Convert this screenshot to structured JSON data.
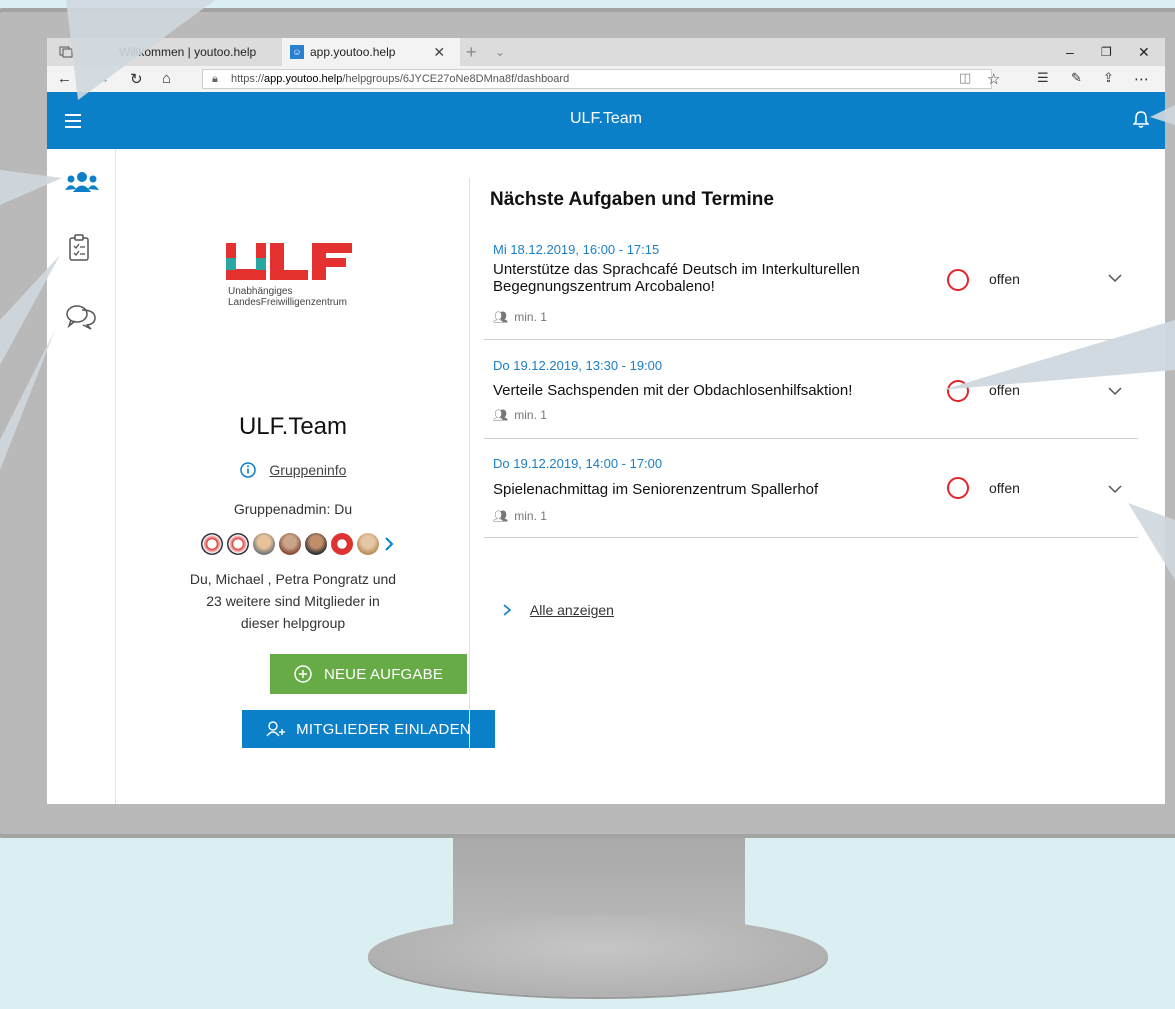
{
  "browser": {
    "tabs": [
      {
        "label": "Willkommen | youtoo.help"
      },
      {
        "label": "app.youtoo.help"
      }
    ],
    "url_prefix": "https://",
    "url_host": "app.youtoo.help",
    "url_path": "/helpgroups/6JYCE27oNe8DMna8f/dashboard"
  },
  "app": {
    "title": "ULF.Team",
    "brand_color": "#0b80c8"
  },
  "logo": {
    "wordmark": "ULF",
    "subtitle_line1": "Unabhängiges",
    "subtitle_line2": "LandesFreiwilligenzentrum"
  },
  "group": {
    "name": "ULF.Team",
    "info_link": "Gruppeninfo",
    "admin_label": "Gruppenadmin:",
    "admin_value": "Du",
    "members_text": "Du, Michael , Petra Pongratz und 23 weitere sind Mitglieder in dieser helpgroup",
    "new_task_button": "NEUE AUFGABE",
    "invite_button": "MITGLIEDER EINLADEN"
  },
  "tasks": {
    "heading": "Nächste Aufgaben und Termine",
    "items": [
      {
        "date": "Mi 18.12.2019, 16:00 - 17:15",
        "title": "Unterstütze das Sprachcafé Deutsch im Interkulturellen Begegnungszentrum Arcobaleno!",
        "min": "min. 1",
        "status": "offen"
      },
      {
        "date": "Do 19.12.2019, 13:30 - 19:00",
        "title": "Verteile Sachspenden mit der Obdachlosenhilfsaktion!",
        "min": "min. 1",
        "status": "offen"
      },
      {
        "date": "Do 19.12.2019, 14:00 - 17:00",
        "title": "Spielenachmittag im Seniorenzentrum Spallerhof",
        "min": "min. 1",
        "status": "offen"
      }
    ],
    "show_all": "Alle anzeigen"
  }
}
